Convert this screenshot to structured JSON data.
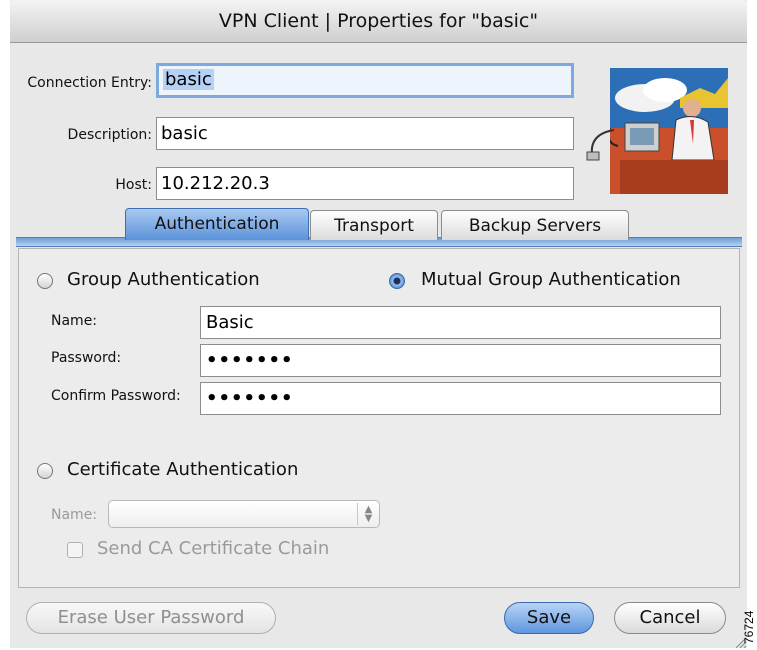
{
  "window": {
    "title": "VPN Client  |  Properties for \"basic\""
  },
  "connection": {
    "entry_label": "Connection Entry:",
    "entry_value": "basic",
    "description_label": "Description:",
    "description_value": "basic",
    "host_label": "Host:",
    "host_value": "10.212.20.3"
  },
  "tabs": [
    {
      "label": "Authentication",
      "active": true
    },
    {
      "label": "Transport",
      "active": false
    },
    {
      "label": "Backup Servers",
      "active": false
    }
  ],
  "auth": {
    "group_label": "Group Authentication",
    "mutual_label": "Mutual Group Authentication",
    "selected": "Mutual Group Authentication",
    "name_label": "Name:",
    "name_value": "Basic",
    "password_label": "Password:",
    "password_value": "•••••••",
    "confirm_label": "Confirm Password:",
    "confirm_value": "•••••••",
    "cert_label": "Certificate Authentication",
    "cert_name_label": "Name:",
    "cert_name_value": "",
    "send_ca_label": "Send CA Certificate Chain"
  },
  "buttons": {
    "erase": "Erase User Password",
    "save": "Save",
    "cancel": "Cancel"
  },
  "figure_number": "76724",
  "colors": {
    "accent": "#5d96de",
    "tab_strip": "#6d9fd9"
  }
}
